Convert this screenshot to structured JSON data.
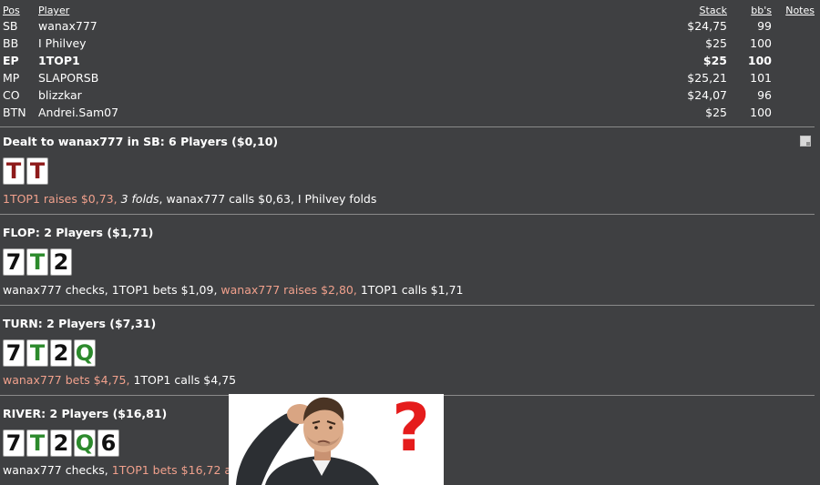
{
  "table": {
    "headers": {
      "pos": "Pos",
      "player": "Player",
      "stack": "Stack",
      "bb": "bb's",
      "notes": "Notes"
    },
    "rows": [
      {
        "pos": "SB",
        "player": "wanax777",
        "stack": "$24,75",
        "bb": "99"
      },
      {
        "pos": "BB",
        "player": "I Philvey",
        "stack": "$25",
        "bb": "100"
      },
      {
        "pos": "EP",
        "player": "1TOP1",
        "stack": "$25",
        "bb": "100"
      },
      {
        "pos": "MP",
        "player": "SLAPORSB",
        "stack": "$25,21",
        "bb": "101"
      },
      {
        "pos": "CO",
        "player": "blizzkar",
        "stack": "$24,07",
        "bb": "96"
      },
      {
        "pos": "BTN",
        "player": "Andrei.Sam07",
        "stack": "$25",
        "bb": "100"
      }
    ]
  },
  "preflop": {
    "title": "Dealt to wanax777 in SB: 6 Players ($0,10)",
    "cards": [
      "T",
      "T"
    ],
    "actions": [
      {
        "text": "1TOP1 raises $0,73,",
        "style": "raise"
      },
      {
        "text": "3 folds",
        "style": "fold-italic"
      },
      {
        "text": ",",
        "style": "normal"
      },
      {
        "text": "wanax777 calls $0,63,",
        "style": "normal"
      },
      {
        "text": "I Philvey folds",
        "style": "normal"
      }
    ]
  },
  "flop": {
    "title": "FLOP: 2 Players ($1,71)",
    "cards": [
      "7",
      "T",
      "2"
    ],
    "actions": [
      {
        "text": "wanax777 checks,",
        "style": "normal"
      },
      {
        "text": "1TOP1 bets $1,09,",
        "style": "normal"
      },
      {
        "text": "wanax777 raises $2,80,",
        "style": "raise"
      },
      {
        "text": "1TOP1 calls $1,71",
        "style": "normal"
      }
    ]
  },
  "turn": {
    "title": "TURN: 2 Players ($7,31)",
    "cards": [
      "7",
      "T",
      "2",
      "Q"
    ],
    "actions": [
      {
        "text": "wanax777 bets $4,75,",
        "style": "raise"
      },
      {
        "text": "1TOP1 calls $4,75",
        "style": "normal"
      }
    ]
  },
  "river": {
    "title": "RIVER: 2 Players ($16,81)",
    "cards": [
      "7",
      "T",
      "2",
      "Q",
      "6"
    ],
    "actions": [
      {
        "text": "wanax777 checks,",
        "style": "normal"
      },
      {
        "text": "1TOP1 bets $16,72 all-in,",
        "style": "raise"
      }
    ]
  },
  "meme": {
    "symbol": "?"
  },
  "colors": {
    "background": "#3f4042",
    "raise": "#f0a08c",
    "card_red": "#8e1a1a",
    "card_green": "#2c8a2c",
    "meme_question": "#e51c1c"
  }
}
